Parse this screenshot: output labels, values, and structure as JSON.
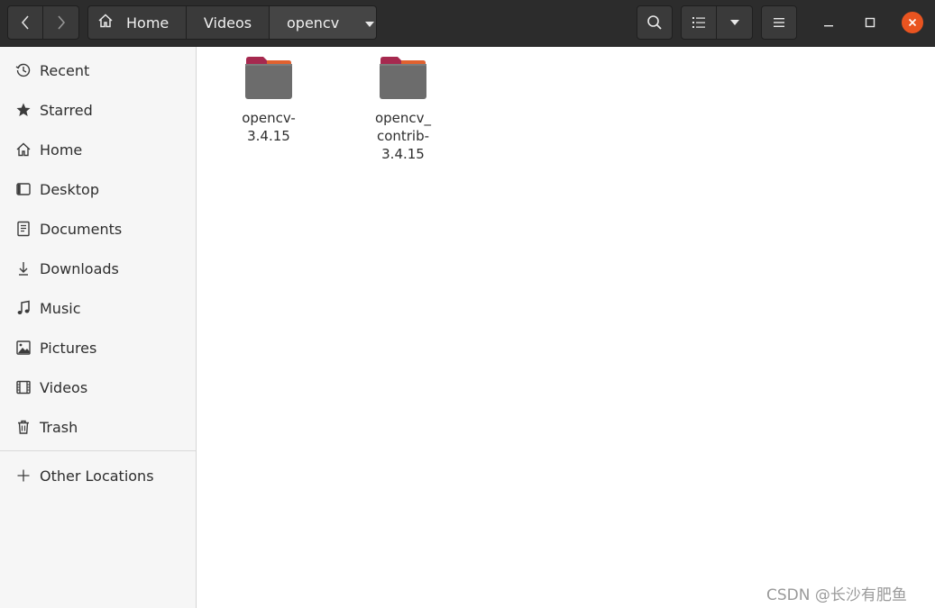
{
  "header": {
    "path": [
      {
        "label": "Home"
      },
      {
        "label": "Videos"
      },
      {
        "label": "opencv"
      }
    ]
  },
  "sidebar": {
    "items": [
      {
        "label": "Recent",
        "icon": "clock-icon"
      },
      {
        "label": "Starred",
        "icon": "star-icon"
      },
      {
        "label": "Home",
        "icon": "home-icon"
      },
      {
        "label": "Desktop",
        "icon": "desktop-icon"
      },
      {
        "label": "Documents",
        "icon": "document-icon"
      },
      {
        "label": "Downloads",
        "icon": "download-icon"
      },
      {
        "label": "Music",
        "icon": "music-icon"
      },
      {
        "label": "Pictures",
        "icon": "picture-icon"
      },
      {
        "label": "Videos",
        "icon": "video-icon"
      },
      {
        "label": "Trash",
        "icon": "trash-icon"
      }
    ],
    "other_locations": {
      "label": "Other Locations",
      "icon": "plus-icon"
    }
  },
  "files": [
    {
      "name_lines": [
        "opencv-",
        "3.4.15"
      ],
      "icon": "folder-icon"
    },
    {
      "name_lines": [
        "opencv_",
        "contrib-",
        "3.4.15"
      ],
      "icon": "folder-icon"
    }
  ],
  "watermark": "CSDN @长沙有肥鱼",
  "colors": {
    "headerbar": "#2c2c2c",
    "accent_close": "#e95420",
    "folder_tab": "#a6294f",
    "folder_body": "#6c6c6c",
    "sidebar_bg": "#f6f6f6"
  }
}
